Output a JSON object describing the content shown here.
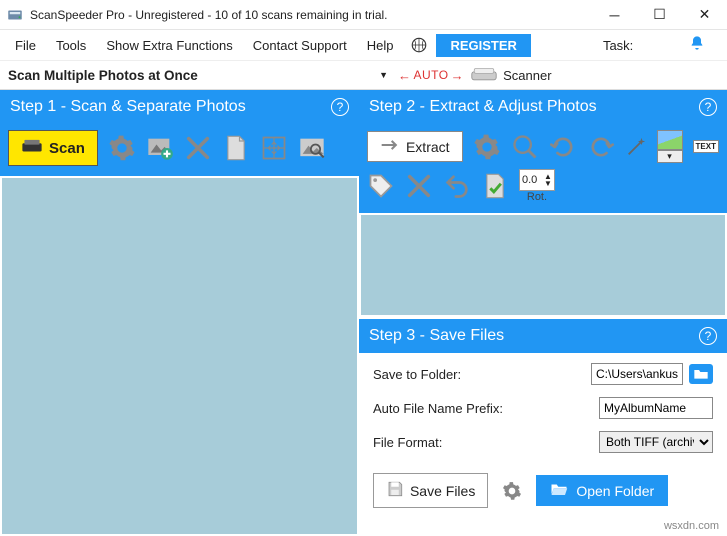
{
  "title": "ScanSpeeder Pro - Unregistered - 10 of 10 scans remaining in trial.",
  "menu": {
    "file": "File",
    "tools": "Tools",
    "showextra": "Show Extra Functions",
    "contact": "Contact Support",
    "help": "Help",
    "register": "REGISTER",
    "task_label": "Task:"
  },
  "context": {
    "title": "Scan Multiple Photos at Once",
    "auto": "AUTO",
    "scanner": "Scanner"
  },
  "step1": {
    "header": "Step 1 - Scan & Separate Photos",
    "scan": "Scan"
  },
  "step2": {
    "header": "Step 2 - Extract & Adjust Photos",
    "extract": "Extract",
    "rot_value": "0.0",
    "rot_label": "Rot."
  },
  "step3": {
    "header": "Step 3 - Save Files",
    "save_to_folder": "Save to Folder:",
    "folder_value": "C:\\Users\\ankus\\",
    "prefix_label": "Auto File Name Prefix:",
    "prefix_value": "MyAlbumName",
    "format_label": "File Format:",
    "format_value": "Both TIFF (archival",
    "save_files": "Save Files",
    "open_folder": "Open Folder"
  },
  "watermark": "wsxdn.com"
}
